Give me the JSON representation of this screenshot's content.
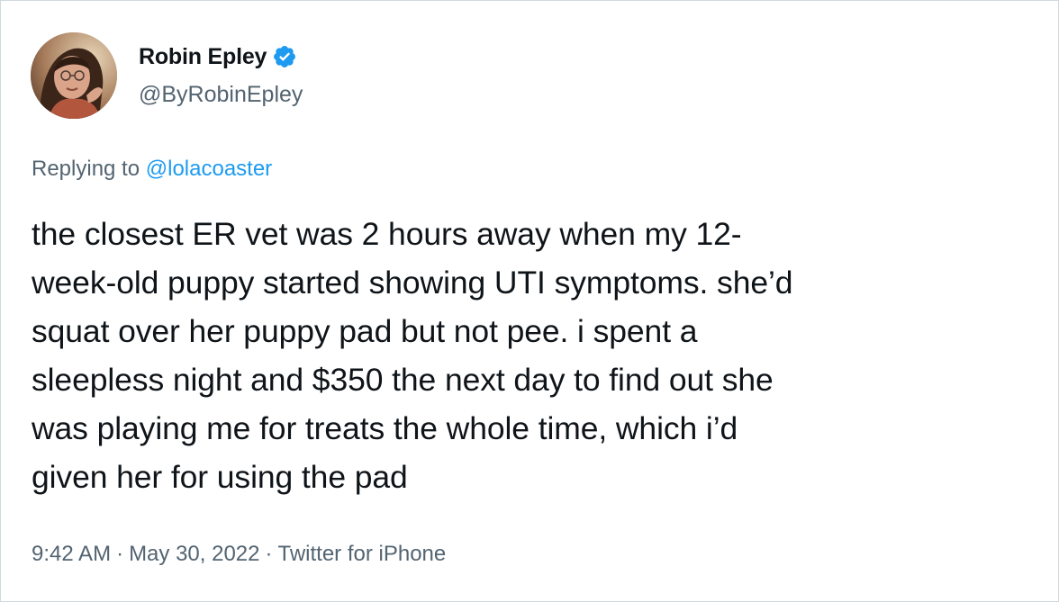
{
  "author": {
    "display_name": "Robin Epley",
    "handle": "@ByRobinEpley",
    "verified": true,
    "avatar_icon": "profile-photo"
  },
  "reply": {
    "prefix": "Replying to",
    "target": "@lolacoaster"
  },
  "tweet": {
    "lines": [
      "the closest ER vet was 2 hours away when my 12-",
      "week-old puppy started showing UTI symptoms. she’d",
      "squat over her puppy pad but not pee. i spent a",
      "sleepless night and $350 the next day to find out she",
      "was playing me for treats the whole time, which i’d",
      "given her for using the pad"
    ]
  },
  "meta": {
    "time": "9:42 AM",
    "separator": "·",
    "date": "May 30, 2022",
    "source": "Twitter for iPhone"
  },
  "colors": {
    "text": "#0f1419",
    "secondary": "#536471",
    "link": "#1d9bf0",
    "verified_badge": "#1d9bf0",
    "border": "#cfd9de"
  }
}
